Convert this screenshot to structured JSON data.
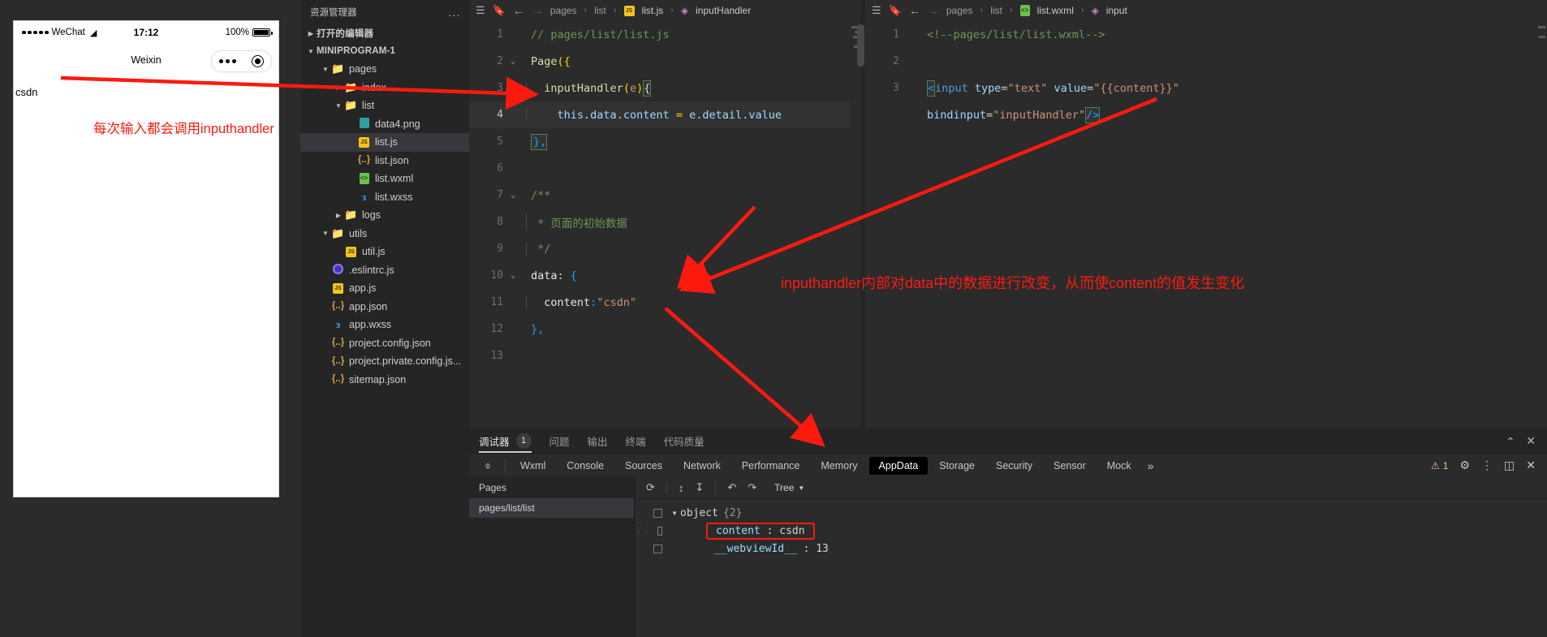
{
  "simulator": {
    "status": {
      "carrier": "WeChat",
      "time": "17:12",
      "battery": "100%"
    },
    "nav_title": "Weixin",
    "input_value": "csdn"
  },
  "annotations": [
    {
      "id": "a1",
      "text": "每次输入都会调用inputhandler"
    },
    {
      "id": "a2",
      "text": "inputhandler内部对data中的数据进行改变，从而使content的值发生变化"
    }
  ],
  "explorer": {
    "title": "资源管理器",
    "ellipsis": "...",
    "open_editors_label": "打开的编辑器",
    "project_label": "MINIPROGRAM-1",
    "tree": [
      {
        "name": "pages",
        "icon": "folder-open-icon",
        "depth": 1,
        "twisty": "▼",
        "selected": false
      },
      {
        "name": "index",
        "icon": "folder-icon",
        "depth": 2,
        "twisty": "▶",
        "selected": false
      },
      {
        "name": "list",
        "icon": "folder-open-icon",
        "depth": 2,
        "twisty": "▼",
        "selected": false
      },
      {
        "name": "data4.png",
        "icon": "image-file-icon",
        "depth": 3,
        "twisty": "",
        "selected": false
      },
      {
        "name": "list.js",
        "icon": "js-file-icon",
        "depth": 3,
        "twisty": "",
        "selected": true
      },
      {
        "name": "list.json",
        "icon": "json-file-icon",
        "depth": 3,
        "twisty": "",
        "selected": false
      },
      {
        "name": "list.wxml",
        "icon": "wxml-file-icon",
        "depth": 3,
        "twisty": "",
        "selected": false
      },
      {
        "name": "list.wxss",
        "icon": "wxss-file-icon",
        "depth": 3,
        "twisty": "",
        "selected": false
      },
      {
        "name": "logs",
        "icon": "folder-icon",
        "depth": 2,
        "twisty": "▶",
        "selected": false
      },
      {
        "name": "utils",
        "icon": "folder-open-icon",
        "depth": 1,
        "twisty": "▼",
        "selected": false
      },
      {
        "name": "util.js",
        "icon": "js-file-icon",
        "depth": 2,
        "twisty": "",
        "selected": false
      },
      {
        "name": ".eslintrc.js",
        "icon": "eslint-file-icon",
        "depth": 1,
        "twisty": "",
        "selected": false
      },
      {
        "name": "app.js",
        "icon": "js-file-icon",
        "depth": 1,
        "twisty": "",
        "selected": false
      },
      {
        "name": "app.json",
        "icon": "json-file-icon",
        "depth": 1,
        "twisty": "",
        "selected": false
      },
      {
        "name": "app.wxss",
        "icon": "wxss-file-icon",
        "depth": 1,
        "twisty": "",
        "selected": false
      },
      {
        "name": "project.config.json",
        "icon": "json-file-icon",
        "depth": 1,
        "twisty": "",
        "selected": false
      },
      {
        "name": "project.private.config.js...",
        "icon": "json-file-icon",
        "depth": 1,
        "twisty": "",
        "selected": false
      },
      {
        "name": "sitemap.json",
        "icon": "json-file-icon",
        "depth": 1,
        "twisty": "",
        "selected": false
      }
    ]
  },
  "editor_left": {
    "breadcrumb": {
      "p1": "pages",
      "p2": "list",
      "file": "list.js",
      "symbol": "inputHandler"
    },
    "lines": [
      {
        "no": "1",
        "fold": "",
        "hl": false
      },
      {
        "no": "2",
        "fold": "⌄",
        "hl": false
      },
      {
        "no": "3",
        "fold": "⌄",
        "hl": false
      },
      {
        "no": "4",
        "fold": "",
        "hl": true
      },
      {
        "no": "5",
        "fold": "",
        "hl": false
      },
      {
        "no": "6",
        "fold": "",
        "hl": false
      },
      {
        "no": "7",
        "fold": "⌄",
        "hl": false
      },
      {
        "no": "8",
        "fold": "",
        "hl": false
      },
      {
        "no": "9",
        "fold": "",
        "hl": false
      },
      {
        "no": "10",
        "fold": "⌄",
        "hl": false
      },
      {
        "no": "11",
        "fold": "",
        "hl": false
      },
      {
        "no": "12",
        "fold": "",
        "hl": false
      },
      {
        "no": "13",
        "fold": "",
        "hl": false
      }
    ],
    "code": {
      "l1_comment": "// pages/list/list.js",
      "l2_page": "Page",
      "l2_paren": "({",
      "l3_fn": "inputHandler",
      "l3_p1": "(",
      "l3_e": "e",
      "l3_p2": ")",
      "l3_brace": "{",
      "l4_this": "this",
      "l4_dot1": ".",
      "l4_data": "data",
      "l4_dot2": ".",
      "l4_content": "content",
      "l4_eq": " = ",
      "l4_e": "e",
      "l4_dot3": ".",
      "l4_detail": "detail",
      "l4_dot4": ".",
      "l4_value": "value",
      "l5": "},",
      "l7": "/**",
      "l8": "* 页面的初始数据",
      "l9": "*/",
      "l10_data": "data",
      "l10_colon": ": ",
      "l10_brace": "{",
      "l11_key": "content",
      "l11_colon": ":",
      "l11_val": "\"csdn\"",
      "l12": "},"
    }
  },
  "editor_right": {
    "breadcrumb": {
      "p1": "pages",
      "p2": "list",
      "file": "list.wxml",
      "symbol": "input"
    },
    "lines": [
      {
        "no": "1",
        "hl": false
      },
      {
        "no": "2",
        "hl": false
      },
      {
        "no": "3",
        "hl": false
      }
    ],
    "code": {
      "l1_comment": "<!--pages/list/list.wxml-->",
      "l3_lt": "<",
      "l3_tag": "input",
      "l3_a1": "type",
      "l3_eq1": "=",
      "l3_v1": "\"text\"",
      "l3_a2": "value",
      "l3_eq2": "=",
      "l3_v2": "\"{{content}}\"",
      "l3b_a3": "bindinput",
      "l3b_eq3": "=",
      "l3b_v3": "\"inputHandler\"",
      "l3b_close": "/>"
    }
  },
  "devtools": {
    "tabs": [
      {
        "label": "调试器",
        "badge": "1",
        "active": true
      },
      {
        "label": "问题",
        "badge": "",
        "active": false
      },
      {
        "label": "输出",
        "badge": "",
        "active": false
      },
      {
        "label": "终端",
        "badge": "",
        "active": false
      },
      {
        "label": "代码质量",
        "badge": "",
        "active": false
      }
    ],
    "panel_tabs": [
      {
        "label": "Wxml",
        "active": false
      },
      {
        "label": "Console",
        "active": false
      },
      {
        "label": "Sources",
        "active": false
      },
      {
        "label": "Network",
        "active": false
      },
      {
        "label": "Performance",
        "active": false
      },
      {
        "label": "Memory",
        "active": false
      },
      {
        "label": "AppData",
        "active": true
      },
      {
        "label": "Storage",
        "active": false
      },
      {
        "label": "Security",
        "active": false
      },
      {
        "label": "Sensor",
        "active": false
      },
      {
        "label": "Mock",
        "active": false
      }
    ],
    "more_label": "»",
    "warning_count": "1",
    "pages_header": "Pages",
    "pages_items": [
      "pages/list/list"
    ],
    "tree_mode": "Tree",
    "appdata": {
      "root_label": "object",
      "root_count": "{2}",
      "rows": [
        {
          "key": "content",
          "sep": " : ",
          "value": "csdn",
          "highlighted": true
        },
        {
          "key": "__webviewId__",
          "sep": " : ",
          "value": "13",
          "highlighted": false
        }
      ]
    }
  },
  "colors": {
    "annotation_red": "#fc1a0f",
    "accent_js": "#f5c518",
    "editor_bg": "#2b2b2b",
    "panel_bg": "#252526"
  }
}
